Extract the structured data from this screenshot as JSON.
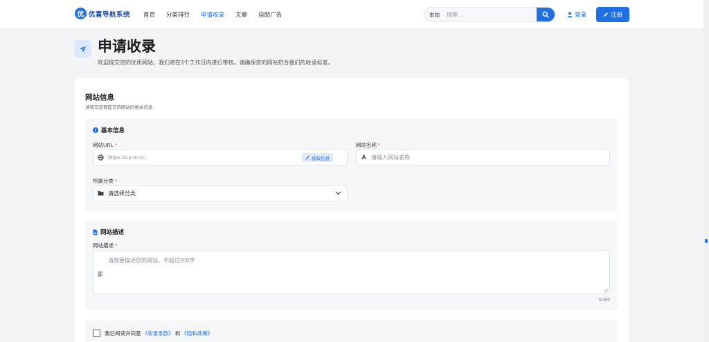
{
  "brand": {
    "logo_char": "优",
    "name": "优喜导航系统"
  },
  "nav": [
    "首页",
    "分类排行",
    "申请收录",
    "文章",
    "自助广告"
  ],
  "nav_active": "申请收录",
  "search": {
    "scope": "本站",
    "placeholder": "搜索..."
  },
  "auth": {
    "login": "登录",
    "register": "注册"
  },
  "page": {
    "title": "申请收录",
    "subtitle": "欢迎提交您的优质网站，我们将在3个工作日内进行审核。请确保您的网站符合我们的收录标准。"
  },
  "card": {
    "title": "网站信息",
    "subtitle": "请填写您要提交的网站的相关信息"
  },
  "basic": {
    "heading": "基本信息",
    "url_label": "网站URL",
    "url_placeholder": "https://v.y-m.cc",
    "fetch_label": "获取信息",
    "name_label": "网站名称",
    "name_placeholder": "请输入网站名称",
    "name_glyph": "A",
    "category_label": "所属分类",
    "category_value": "请选择分类",
    "required_mark": "*"
  },
  "desc": {
    "heading": "网站描述",
    "label": "网站描述",
    "placeholder": "请简要描述您的网站，不超过200字",
    "counter": "0/200"
  },
  "agree": {
    "prefix": "我已阅读并同意",
    "terms": "《收录条款》",
    "and": "和",
    "privacy": "《隐私政策》"
  },
  "colors": {
    "accent": "#1f6fe5",
    "required": "#e5484d"
  }
}
